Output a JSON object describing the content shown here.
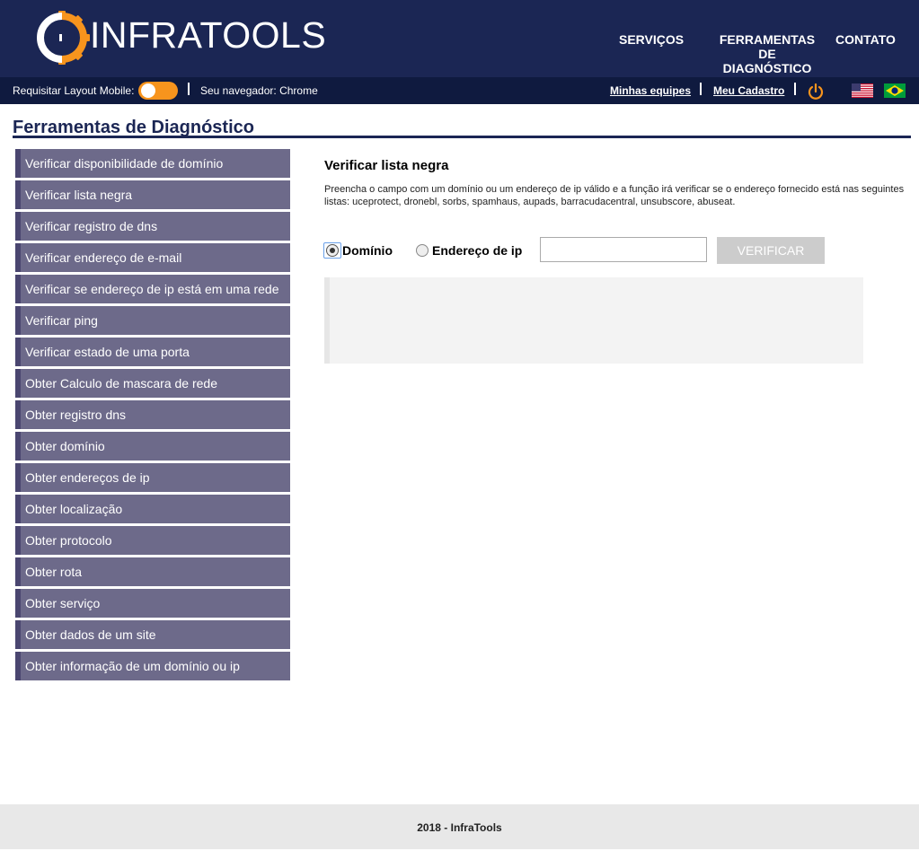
{
  "header": {
    "logo_text": "INFRATOOLS",
    "nav": [
      {
        "label": "SERVIÇOS"
      },
      {
        "label_lines": [
          "FERRAMENTAS",
          "DE",
          "DIAGNÓSTICO"
        ]
      },
      {
        "label": "CONTATO"
      }
    ]
  },
  "subbar": {
    "mobile_label": "Requisitar Layout Mobile:",
    "browser_label": "Seu navegador: Chrome",
    "link_teams": "Minhas equipes",
    "link_register": "Meu Cadastro",
    "power_icon": "power-icon",
    "flags": [
      "us-flag-icon",
      "brazil-flag-icon"
    ]
  },
  "page_title": "Ferramentas de Diagnóstico",
  "sidebar": {
    "items": [
      "Verificar disponibilidade de domínio",
      "Verificar lista negra",
      "Verificar registro de dns",
      "Verificar endereço de e-mail",
      "Verificar se endereço de ip está em uma rede",
      "Verificar ping",
      "Verificar estado de uma porta",
      "Obter Calculo de mascara de rede",
      "Obter registro dns",
      "Obter domínio",
      "Obter endereços de ip",
      "Obter localização",
      "Obter protocolo",
      "Obter rota",
      "Obter serviço",
      "Obter dados de um site",
      "Obter informação de um domínio ou ip"
    ]
  },
  "main": {
    "title": "Verificar lista negra",
    "description": "Preencha o campo com um domínio ou um endereço de ip válido e a função irá verificar se o endereço fornecido está nas seguintes listas: uceprotect, dronebl, sorbs, spamhaus, aupads, barracudacentral, unsubscore, abuseat.",
    "radio_domain": "Domínio",
    "radio_ip": "Endereço de ip",
    "input_value": "",
    "verify_button": "VERIFICAR"
  },
  "footer": "2018 - InfraTools",
  "colors": {
    "header_bg": "#1b2654",
    "subbar_bg": "#0f1a3f",
    "accent": "#f7941d",
    "sidebar_bg": "#6d6a8a"
  }
}
